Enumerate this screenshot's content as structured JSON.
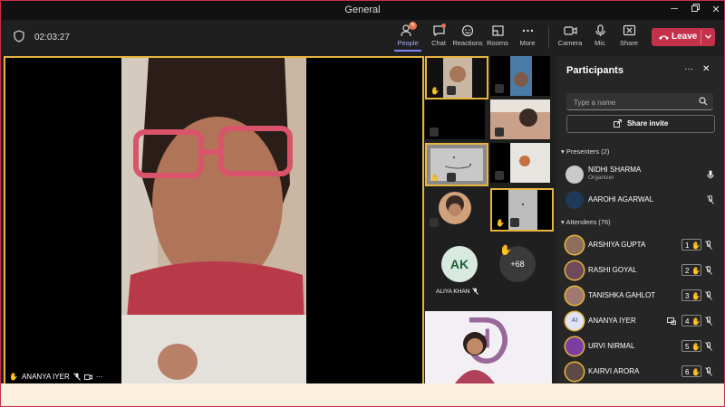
{
  "window": {
    "title": "General"
  },
  "meeting": {
    "elapsed": "02:03:27"
  },
  "toolbar": {
    "people": {
      "label": "People",
      "badge": "6"
    },
    "chat": {
      "label": "Chat"
    },
    "reactions": {
      "label": "Reactions"
    },
    "rooms": {
      "label": "Rooms"
    },
    "more": {
      "label": "More"
    },
    "camera": {
      "label": "Camera"
    },
    "mic": {
      "label": "Mic"
    },
    "share": {
      "label": "Share"
    },
    "leave": {
      "label": "Leave"
    }
  },
  "stage": {
    "speaker_name": "ANANYA IYER"
  },
  "grid": {
    "aliya": {
      "initials": "AK",
      "name": "ALIYA KHAN"
    },
    "overflow": {
      "count": "+68"
    }
  },
  "panel": {
    "title": "Participants",
    "search_placeholder": "Type a name",
    "share_invite": "Share invite",
    "presenters_header": "Presenters (2)",
    "attendees_header": "Attendees (76)",
    "presenters": [
      {
        "name": "NIDHI SHARMA",
        "role": "Organizer"
      },
      {
        "name": "AAROHI AGARWAL"
      }
    ],
    "attendees": [
      {
        "name": "ARSHIYA GUPTA",
        "hand": "1"
      },
      {
        "name": "RASHI GOYAL",
        "hand": "2"
      },
      {
        "name": "TANISHKA GAHLOT",
        "hand": "3"
      },
      {
        "name": "ANANYA IYER",
        "initials": "AI",
        "hand": "4"
      },
      {
        "name": "URVI NIRMAL",
        "hand": "5"
      },
      {
        "name": "KAIRVI ARORA",
        "hand": "6"
      }
    ]
  },
  "colors": {
    "accent": "#7f85f5",
    "leave": "#c4314b",
    "highlight": "#e7b53d"
  }
}
